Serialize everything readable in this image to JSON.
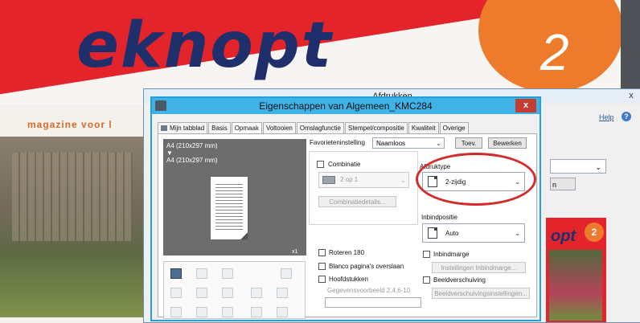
{
  "magazine": {
    "logo_text": "eknopt",
    "issue_number": "2",
    "subtitle": "magazine voor l",
    "preview_logo": "opt",
    "preview_number": "2"
  },
  "back_dialog": {
    "title": "Afdrukken",
    "close": "x",
    "help_label": "Help",
    "help_icon": "?",
    "partial_button": "n"
  },
  "dialog": {
    "title": "Eigenschappen van Algemeen_KMC284",
    "close": "x"
  },
  "tabs": [
    {
      "label": "Mijn tabblad"
    },
    {
      "label": "Basis"
    },
    {
      "label": "Opmaak",
      "active": true
    },
    {
      "label": "Voltooien"
    },
    {
      "label": "Omslagfunctie"
    },
    {
      "label": "Stempel/compositie"
    },
    {
      "label": "Kwaliteit"
    },
    {
      "label": "Overige"
    }
  ],
  "preview": {
    "line1": "A4 (210x297 mm)",
    "arrow": "▼",
    "line2": "A4 (210x297 mm)",
    "count": "x1"
  },
  "favorites": {
    "label": "Favorieteninstelling",
    "value": "Naamloos",
    "add_button": "Toev.",
    "edit_button": "Bewerken"
  },
  "combination": {
    "label": "Combinatie",
    "value": "2 op 1",
    "details_button": "Combinatiedetails..."
  },
  "print_type": {
    "label": "Afdruktype",
    "value": "2-zijdig"
  },
  "binding": {
    "label": "Inbindpositie",
    "value": "Auto"
  },
  "checkboxes": {
    "rotate": "Roteren 180",
    "skip_blank": "Blanco pagina's overslaan",
    "chapters": "Hoofdstukken",
    "chapters_placeholder": "Gegevensvoorbeeld 2,4,6-10",
    "margin": "Inbindmarge",
    "margin_button": "Instellingen Inbindmarge...",
    "shift": "Beeldverschuiving",
    "shift_button": "Beeldverschuivingsinstellingen..."
  },
  "colors": {
    "accent_red": "#e3242b",
    "brand_blue": "#1e2f6b",
    "orange": "#ee7a2c",
    "title_bar": "#3fb3e8",
    "highlight": "#d22d2d"
  }
}
